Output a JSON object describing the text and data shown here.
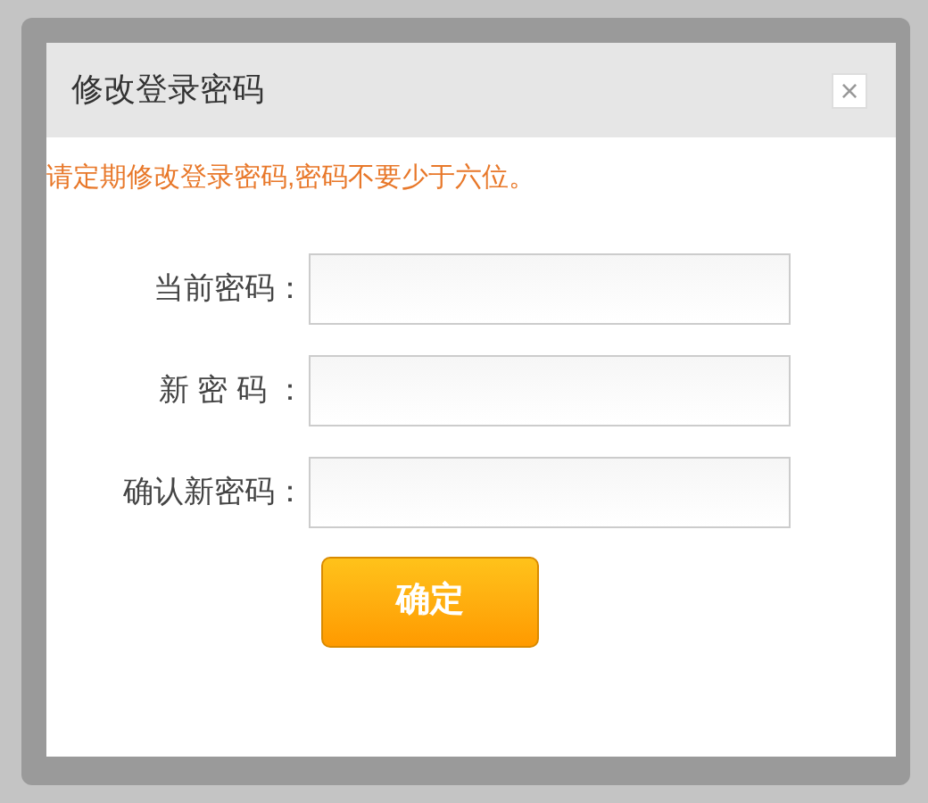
{
  "dialog": {
    "title": "修改登录密码",
    "close": "×",
    "message": "请定期修改登录密码,密码不要少于六位。",
    "fields": [
      {
        "label": "当前密码："
      },
      {
        "label": "新 密 码 ："
      },
      {
        "label": "确认新密码："
      }
    ],
    "submit": "确定"
  }
}
